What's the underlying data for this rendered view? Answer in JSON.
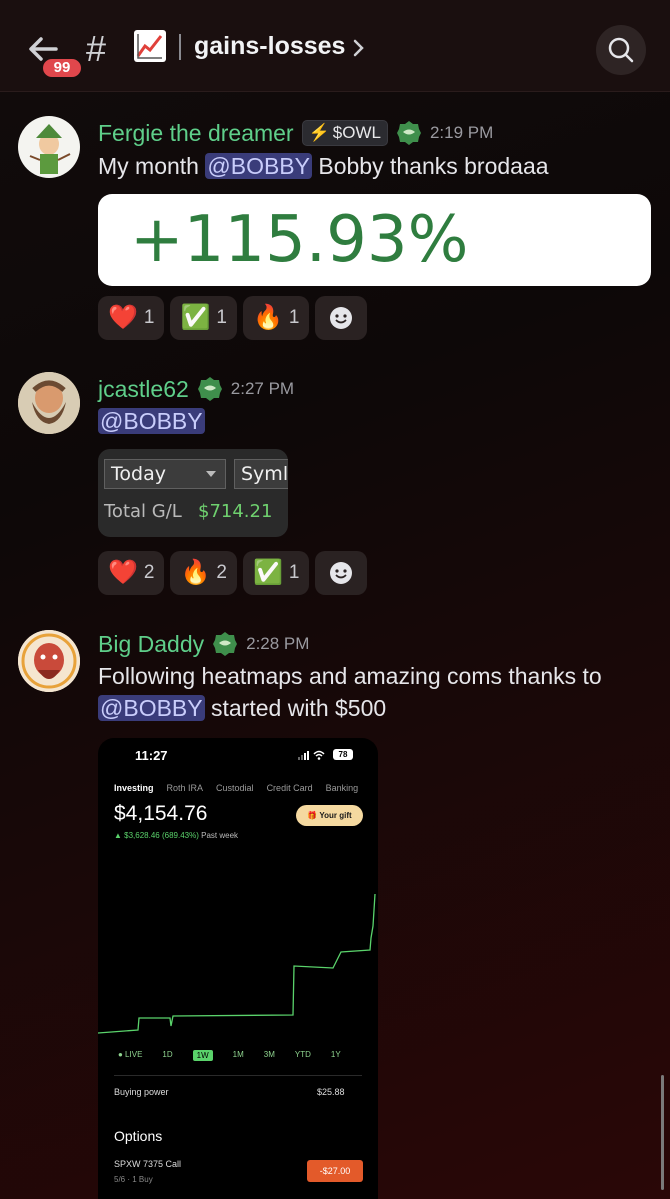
{
  "header": {
    "unread_badge": "99",
    "hash_symbol": "#",
    "channel_name": "gains-losses"
  },
  "messages": [
    {
      "author": "Fergie the dreamer",
      "tag": "$OWL",
      "time": "2:19 PM",
      "text_before": "My month ",
      "mention": "@BOBBY",
      "text_after": " Bobby thanks brodaaa",
      "embed": {
        "value": "+115.93%"
      },
      "reactions": [
        {
          "emoji": "❤️",
          "count": "1"
        },
        {
          "emoji": "✅",
          "count": "1"
        },
        {
          "emoji": "🔥",
          "count": "1"
        }
      ]
    },
    {
      "author": "jcastle62",
      "time": "2:27 PM",
      "mention": "@BOBBY",
      "embed": {
        "dropdown": "Today",
        "dropdown2": "Syml",
        "label": "Total G/L",
        "value": "$714.21"
      },
      "reactions": [
        {
          "emoji": "❤️",
          "count": "2"
        },
        {
          "emoji": "🔥",
          "count": "2"
        },
        {
          "emoji": "✅",
          "count": "1"
        }
      ]
    },
    {
      "author": "Big Daddy",
      "time": "2:28 PM",
      "line1": "Following heatmaps and amazing coms thanks to",
      "mention": "@BOBBY",
      "line2_after": " started with $500",
      "screenshot": {
        "time": "11:27",
        "battery": "78",
        "tabs": [
          "Investing",
          "Roth IRA",
          "Custodial",
          "Credit Card",
          "Banking"
        ],
        "balance": "$4,154.76",
        "gift": "Your gift",
        "change": "▲ $3,628.46 (689.43%)",
        "change_period": "Past week",
        "ranges": [
          "● LIVE",
          "1D",
          "1W",
          "1M",
          "3M",
          "YTD",
          "1Y"
        ],
        "buying_power_label": "Buying power",
        "buying_power_value": "$25.88",
        "options_label": "Options",
        "contract_name": "SPXW 7375 Call",
        "contract_sub": "5/6 · 1 Buy",
        "contract_value": "-$27.00",
        "chart_points": [
          [
            0,
            95
          ],
          [
            40,
            92
          ],
          [
            41,
            80
          ],
          [
            72,
            80
          ],
          [
            73,
            88
          ],
          [
            75,
            78
          ],
          [
            195,
            77
          ],
          [
            196,
            28
          ],
          [
            235,
            30
          ],
          [
            243,
            14
          ],
          [
            272,
            12
          ],
          [
            273,
            0
          ],
          [
            275,
            -12
          ],
          [
            277,
            -44
          ]
        ]
      }
    }
  ],
  "colors": {
    "accent": "#5fcf8a",
    "mention_bg": "#3a3c7a",
    "badge": "#e0474c"
  }
}
